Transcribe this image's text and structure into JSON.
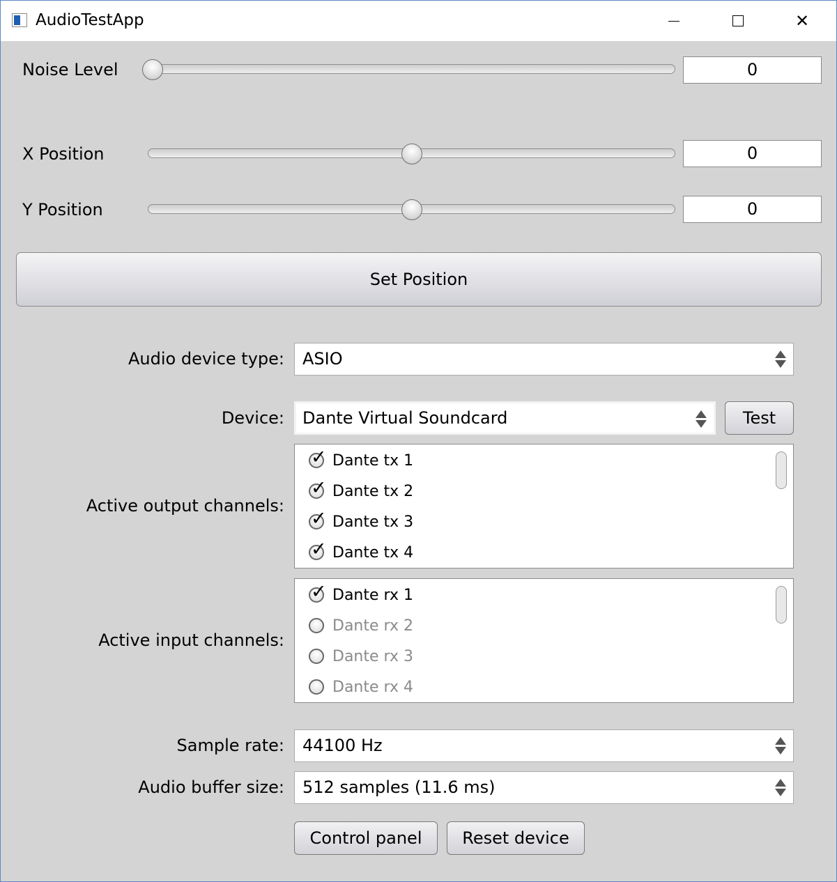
{
  "window": {
    "title": "AudioTestApp"
  },
  "sliders": [
    {
      "label": "Noise Level",
      "value": "0",
      "position": 0.0
    },
    {
      "label": "X Position",
      "value": "0",
      "position": 0.5
    },
    {
      "label": "Y Position",
      "value": "0",
      "position": 0.5
    }
  ],
  "set_position_label": "Set Position",
  "audio": {
    "device_type_label": "Audio device type:",
    "device_type_value": "ASIO",
    "device_label": "Device:",
    "device_value": "Dante Virtual Soundcard",
    "test_label": "Test",
    "output_label": "Active output channels:",
    "output_channels": [
      {
        "name": "Dante tx 1",
        "checked": true
      },
      {
        "name": "Dante tx 2",
        "checked": true
      },
      {
        "name": "Dante tx 3",
        "checked": true
      },
      {
        "name": "Dante tx 4",
        "checked": true
      }
    ],
    "input_label": "Active input channels:",
    "input_channels": [
      {
        "name": "Dante rx 1",
        "checked": true
      },
      {
        "name": "Dante rx 2",
        "checked": false
      },
      {
        "name": "Dante rx 3",
        "checked": false
      },
      {
        "name": "Dante rx 4",
        "checked": false
      }
    ],
    "sample_rate_label": "Sample rate:",
    "sample_rate_value": "44100 Hz",
    "buffer_label": "Audio buffer size:",
    "buffer_value": "512 samples (11.6 ms)",
    "control_panel_label": "Control panel",
    "reset_label": "Reset device"
  }
}
